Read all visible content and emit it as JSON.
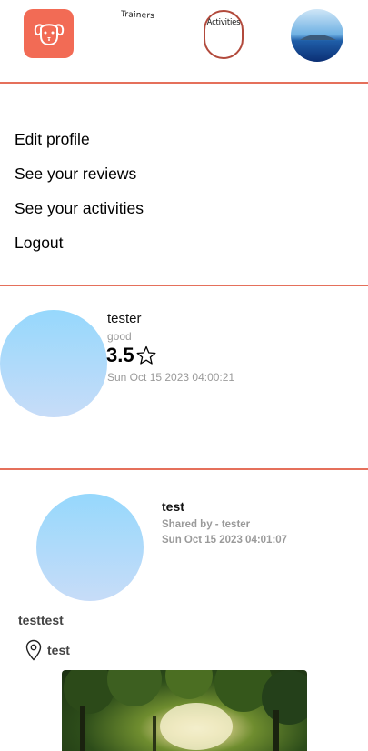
{
  "nav": {
    "logo_icon": "dog-face-icon",
    "trainers_label": "Trainers",
    "activities_label": "Activities",
    "avatar_icon": "profile-photo"
  },
  "menu": {
    "items": [
      {
        "label": "Edit profile"
      },
      {
        "label": "See your reviews"
      },
      {
        "label": "See your activities"
      },
      {
        "label": "Logout"
      }
    ]
  },
  "review": {
    "name": "tester",
    "comment": "good",
    "rating": "3.5",
    "date": "Sun Oct 15 2023 04:00:21"
  },
  "activity": {
    "title": "test",
    "shared_by": "Shared by - tester",
    "date": "Sun Oct 15 2023 04:01:07",
    "description": "testtest",
    "location": "test"
  },
  "colors": {
    "accent": "#f26b55",
    "rule": "#e5705b",
    "muted_text": "#9a9a9a"
  }
}
